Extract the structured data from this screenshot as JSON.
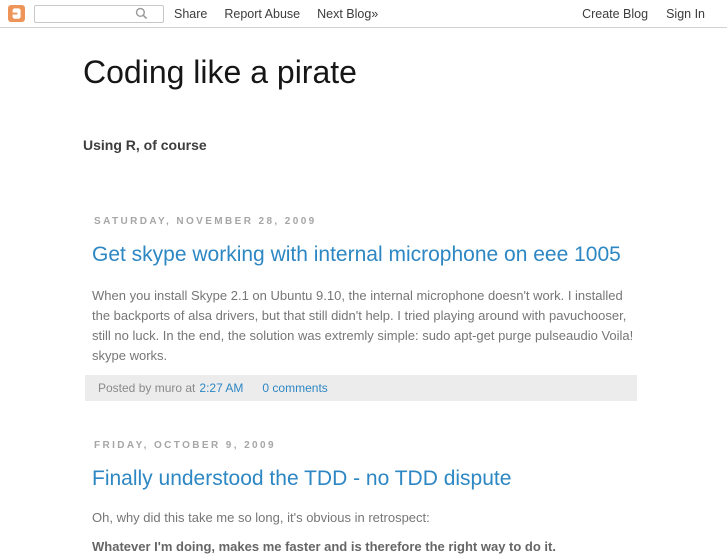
{
  "navbar": {
    "logo_icon": "blogger-icon",
    "search": {
      "value": "",
      "placeholder": "",
      "button_icon": "search-icon"
    },
    "links": {
      "share": "Share",
      "report_abuse": "Report Abuse",
      "next_blog": "Next Blog»"
    },
    "right_links": {
      "create_blog": "Create Blog",
      "sign_in": "Sign In"
    }
  },
  "header": {
    "title": "Coding like a pirate",
    "subtitle": "Using R, of course"
  },
  "posts": [
    {
      "date": "SATURDAY, NOVEMBER 28, 2009",
      "title": "Get skype working with internal microphone on eee 1005",
      "body": "When you install Skype 2.1 on Ubuntu 9.10, the internal microphone doesn't work. I installed the backports of alsa drivers, but that still didn't help. I tried playing around with pavuchooser, still no luck. In the end, the solution was extremly simple: sudo apt-get purge pulseaudio Voila! skype works.",
      "footer": {
        "posted_by": "Posted by muro at",
        "timestamp": "2:27 AM",
        "comments": "0 comments"
      }
    },
    {
      "date": "FRIDAY, OCTOBER 9, 2009",
      "title": "Finally understood the TDD - no TDD dispute",
      "body_intro": "Oh, why did this take me so long, it's obvious in retrospect:",
      "body_emphasis": "Whatever I'm doing, makes me faster and is therefore the right way to do it."
    }
  ],
  "colors": {
    "link_blue": "#2d87c3",
    "blogger_orange": "#ef9459",
    "date_gray": "#a6a6a6",
    "body_gray": "#767676",
    "footer_bg": "#ececec"
  }
}
